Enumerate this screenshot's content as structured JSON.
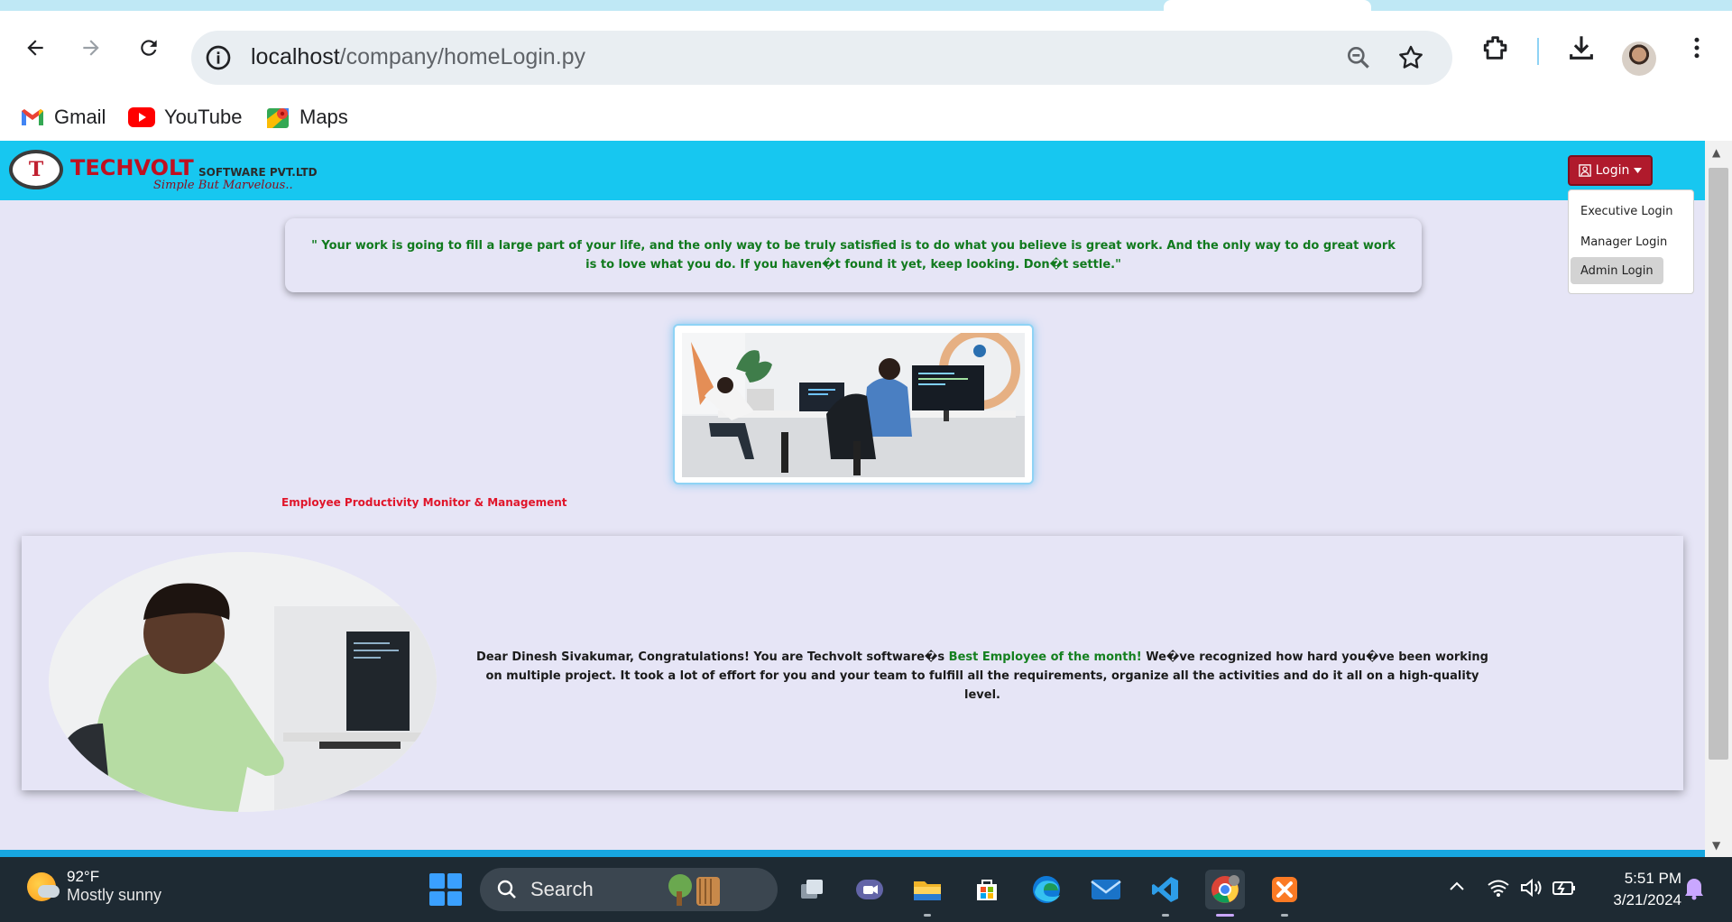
{
  "browser": {
    "url_host": "localhost",
    "url_path": "/company/homeLogin.py",
    "bookmarks": [
      {
        "label": "Gmail",
        "icon": "gmail-icon"
      },
      {
        "label": "YouTube",
        "icon": "youtube-icon"
      },
      {
        "label": "Maps",
        "icon": "maps-icon"
      }
    ]
  },
  "header": {
    "brand": "TECHVOLT",
    "brand_suffix": "SOFTWARE PVT.LTD",
    "tagline": "Simple But Marvelous..",
    "login_label": "Login",
    "login_menu": [
      "Executive Login",
      "Manager Login",
      "Admin Login"
    ],
    "active_menu_item": "Admin Login"
  },
  "quote": "\" Your work is going to fill a large part of your life, and the only way to be truly satisfied is to do what you believe is great work. And the only way to do great work is to love what you do. If you haven�t found it yet, keep looking. Don�t settle.\"",
  "tagline": "Employee Productivity Monitor & Management",
  "employee": {
    "text_before": "Dear Dinesh Sivakumar, Congratulations! You are Techvolt software�s ",
    "highlight": "Best Employee of the month!",
    "text_after": " We�ve recognized how hard you�ve been working on multiple project. It took a lot of effort for you and your team to fulfill all the requirements, organize all the activities and do it all on a high-quality level."
  },
  "taskbar": {
    "temperature": "92°F",
    "weather": "Mostly sunny",
    "search_label": "Search",
    "time": "5:51 PM",
    "date": "3/21/2024"
  },
  "colors": {
    "header_bg": "#17c7f0",
    "page_bg": "#e6e5f6",
    "quote_text": "#117a1e",
    "tagline_text": "#e0152a",
    "login_button": "#b01a2c"
  }
}
